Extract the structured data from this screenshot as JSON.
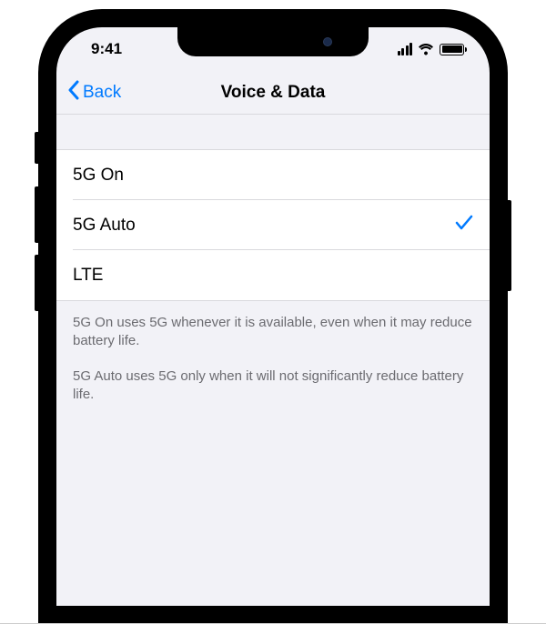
{
  "status": {
    "time": "9:41"
  },
  "nav": {
    "back_label": "Back",
    "title": "Voice & Data"
  },
  "options": [
    {
      "label": "5G On",
      "selected": false
    },
    {
      "label": "5G Auto",
      "selected": true
    },
    {
      "label": "LTE",
      "selected": false
    }
  ],
  "footer": {
    "p1": "5G On uses 5G whenever it is available, even when it may reduce battery life.",
    "p2": "5G Auto uses 5G only when it will not significantly reduce battery life."
  },
  "colors": {
    "accent": "#007AFF",
    "background": "#f2f2f7"
  }
}
